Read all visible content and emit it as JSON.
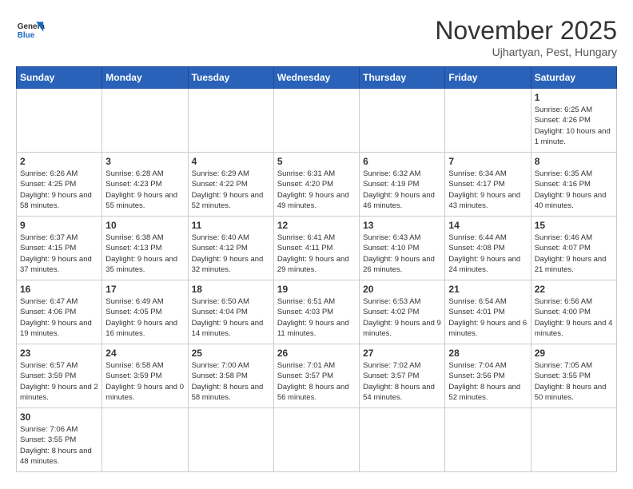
{
  "logo": {
    "text_general": "General",
    "text_blue": "Blue"
  },
  "header": {
    "title": "November 2025",
    "subtitle": "Ujhartyan, Pest, Hungary"
  },
  "weekdays": [
    "Sunday",
    "Monday",
    "Tuesday",
    "Wednesday",
    "Thursday",
    "Friday",
    "Saturday"
  ],
  "weeks": [
    [
      {
        "day": "",
        "info": ""
      },
      {
        "day": "",
        "info": ""
      },
      {
        "day": "",
        "info": ""
      },
      {
        "day": "",
        "info": ""
      },
      {
        "day": "",
        "info": ""
      },
      {
        "day": "",
        "info": ""
      },
      {
        "day": "1",
        "info": "Sunrise: 6:25 AM\nSunset: 4:26 PM\nDaylight: 10 hours\nand 1 minute."
      }
    ],
    [
      {
        "day": "2",
        "info": "Sunrise: 6:26 AM\nSunset: 4:25 PM\nDaylight: 9 hours\nand 58 minutes."
      },
      {
        "day": "3",
        "info": "Sunrise: 6:28 AM\nSunset: 4:23 PM\nDaylight: 9 hours\nand 55 minutes."
      },
      {
        "day": "4",
        "info": "Sunrise: 6:29 AM\nSunset: 4:22 PM\nDaylight: 9 hours\nand 52 minutes."
      },
      {
        "day": "5",
        "info": "Sunrise: 6:31 AM\nSunset: 4:20 PM\nDaylight: 9 hours\nand 49 minutes."
      },
      {
        "day": "6",
        "info": "Sunrise: 6:32 AM\nSunset: 4:19 PM\nDaylight: 9 hours\nand 46 minutes."
      },
      {
        "day": "7",
        "info": "Sunrise: 6:34 AM\nSunset: 4:17 PM\nDaylight: 9 hours\nand 43 minutes."
      },
      {
        "day": "8",
        "info": "Sunrise: 6:35 AM\nSunset: 4:16 PM\nDaylight: 9 hours\nand 40 minutes."
      }
    ],
    [
      {
        "day": "9",
        "info": "Sunrise: 6:37 AM\nSunset: 4:15 PM\nDaylight: 9 hours\nand 37 minutes."
      },
      {
        "day": "10",
        "info": "Sunrise: 6:38 AM\nSunset: 4:13 PM\nDaylight: 9 hours\nand 35 minutes."
      },
      {
        "day": "11",
        "info": "Sunrise: 6:40 AM\nSunset: 4:12 PM\nDaylight: 9 hours\nand 32 minutes."
      },
      {
        "day": "12",
        "info": "Sunrise: 6:41 AM\nSunset: 4:11 PM\nDaylight: 9 hours\nand 29 minutes."
      },
      {
        "day": "13",
        "info": "Sunrise: 6:43 AM\nSunset: 4:10 PM\nDaylight: 9 hours\nand 26 minutes."
      },
      {
        "day": "14",
        "info": "Sunrise: 6:44 AM\nSunset: 4:08 PM\nDaylight: 9 hours\nand 24 minutes."
      },
      {
        "day": "15",
        "info": "Sunrise: 6:46 AM\nSunset: 4:07 PM\nDaylight: 9 hours\nand 21 minutes."
      }
    ],
    [
      {
        "day": "16",
        "info": "Sunrise: 6:47 AM\nSunset: 4:06 PM\nDaylight: 9 hours\nand 19 minutes."
      },
      {
        "day": "17",
        "info": "Sunrise: 6:49 AM\nSunset: 4:05 PM\nDaylight: 9 hours\nand 16 minutes."
      },
      {
        "day": "18",
        "info": "Sunrise: 6:50 AM\nSunset: 4:04 PM\nDaylight: 9 hours\nand 14 minutes."
      },
      {
        "day": "19",
        "info": "Sunrise: 6:51 AM\nSunset: 4:03 PM\nDaylight: 9 hours\nand 11 minutes."
      },
      {
        "day": "20",
        "info": "Sunrise: 6:53 AM\nSunset: 4:02 PM\nDaylight: 9 hours\nand 9 minutes."
      },
      {
        "day": "21",
        "info": "Sunrise: 6:54 AM\nSunset: 4:01 PM\nDaylight: 9 hours\nand 6 minutes."
      },
      {
        "day": "22",
        "info": "Sunrise: 6:56 AM\nSunset: 4:00 PM\nDaylight: 9 hours\nand 4 minutes."
      }
    ],
    [
      {
        "day": "23",
        "info": "Sunrise: 6:57 AM\nSunset: 3:59 PM\nDaylight: 9 hours\nand 2 minutes."
      },
      {
        "day": "24",
        "info": "Sunrise: 6:58 AM\nSunset: 3:59 PM\nDaylight: 9 hours\nand 0 minutes."
      },
      {
        "day": "25",
        "info": "Sunrise: 7:00 AM\nSunset: 3:58 PM\nDaylight: 8 hours\nand 58 minutes."
      },
      {
        "day": "26",
        "info": "Sunrise: 7:01 AM\nSunset: 3:57 PM\nDaylight: 8 hours\nand 56 minutes."
      },
      {
        "day": "27",
        "info": "Sunrise: 7:02 AM\nSunset: 3:57 PM\nDaylight: 8 hours\nand 54 minutes."
      },
      {
        "day": "28",
        "info": "Sunrise: 7:04 AM\nSunset: 3:56 PM\nDaylight: 8 hours\nand 52 minutes."
      },
      {
        "day": "29",
        "info": "Sunrise: 7:05 AM\nSunset: 3:55 PM\nDaylight: 8 hours\nand 50 minutes."
      }
    ],
    [
      {
        "day": "30",
        "info": "Sunrise: 7:06 AM\nSunset: 3:55 PM\nDaylight: 8 hours\nand 48 minutes."
      },
      {
        "day": "",
        "info": ""
      },
      {
        "day": "",
        "info": ""
      },
      {
        "day": "",
        "info": ""
      },
      {
        "day": "",
        "info": ""
      },
      {
        "day": "",
        "info": ""
      },
      {
        "day": "",
        "info": ""
      }
    ]
  ]
}
